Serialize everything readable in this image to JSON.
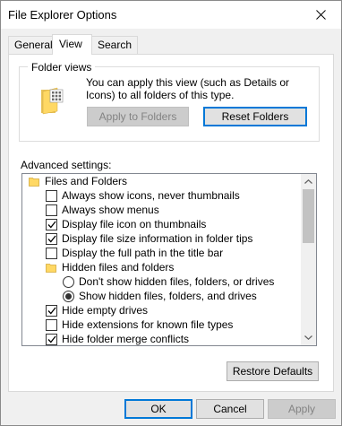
{
  "window": {
    "title": "File Explorer Options"
  },
  "tabs": [
    {
      "label": "General"
    },
    {
      "label": "View"
    },
    {
      "label": "Search"
    }
  ],
  "folder_views": {
    "label": "Folder views",
    "description": "You can apply this view (such as Details or Icons) to all folders of this type.",
    "apply_button": "Apply to Folders",
    "reset_button": "Reset Folders"
  },
  "advanced": {
    "label": "Advanced settings:",
    "items": [
      {
        "type": "folder",
        "label": "Files and Folders"
      },
      {
        "type": "checkbox",
        "checked": false,
        "label": "Always show icons, never thumbnails"
      },
      {
        "type": "checkbox",
        "checked": false,
        "label": "Always show menus"
      },
      {
        "type": "checkbox",
        "checked": true,
        "label": "Display file icon on thumbnails"
      },
      {
        "type": "checkbox",
        "checked": true,
        "label": "Display file size information in folder tips"
      },
      {
        "type": "checkbox",
        "checked": false,
        "label": "Display the full path in the title bar"
      },
      {
        "type": "folder",
        "label": "Hidden files and folders"
      },
      {
        "type": "radio",
        "checked": false,
        "label": "Don't show hidden files, folders, or drives"
      },
      {
        "type": "radio",
        "checked": true,
        "label": "Show hidden files, folders, and drives"
      },
      {
        "type": "checkbox",
        "checked": true,
        "label": "Hide empty drives"
      },
      {
        "type": "checkbox",
        "checked": false,
        "label": "Hide extensions for known file types"
      },
      {
        "type": "checkbox",
        "checked": true,
        "label": "Hide folder merge conflicts"
      }
    ]
  },
  "buttons": {
    "restore_defaults": "Restore Defaults",
    "ok": "OK",
    "cancel": "Cancel",
    "apply": "Apply"
  },
  "colors": {
    "accent": "#0078d7",
    "folder": "#ffd864"
  }
}
